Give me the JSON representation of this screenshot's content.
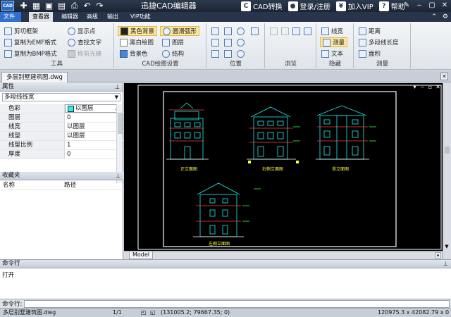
{
  "titlebar": {
    "logo": "CAD",
    "title": "迅捷CAD编辑器",
    "cad_convert": "CAD转换",
    "login": "登录/注册",
    "vip": "加入VIP",
    "help": "帮助",
    "qat_icons": [
      "new-icon",
      "open-icon",
      "save-icon",
      "save-as-icon",
      "print-icon",
      "undo-icon",
      "redo-icon"
    ]
  },
  "menubar": {
    "tabs": [
      "文件",
      "查看器",
      "编辑器",
      "高级",
      "输出",
      "VIP功能"
    ],
    "active": "查看器"
  },
  "ribbon": {
    "tools": {
      "label": "工具",
      "items": [
        "剪切框架",
        "复制为EMF格式",
        "复制为BMP格式",
        "显示点",
        "查找文字",
        "修剪光栅"
      ]
    },
    "cad_settings": {
      "label": "CAD绘图设置",
      "items": [
        "黑色背景",
        "黑白绘图",
        "背景色",
        "圆滑弧形",
        "图层",
        "结构"
      ]
    },
    "position": {
      "label": "位置"
    },
    "browse": {
      "label": "浏览"
    },
    "hide": {
      "label": "隐藏",
      "items": [
        "线宽",
        "测量",
        "文本"
      ]
    },
    "measure": {
      "label": "测量",
      "items": [
        "距离",
        "多段线长度",
        "面积"
      ]
    }
  },
  "file_tab": {
    "name": "多层别墅建筑图.dwg"
  },
  "properties": {
    "title": "属性",
    "selector": "多段线线宽",
    "rows": [
      {
        "key": "色彩",
        "value": "以图层"
      },
      {
        "key": "图层",
        "value": "0"
      },
      {
        "key": "线宽",
        "value": "以图层"
      },
      {
        "key": "线型",
        "value": "以图层"
      },
      {
        "key": "线型比例",
        "value": "1"
      },
      {
        "key": "厚度",
        "value": "0"
      }
    ]
  },
  "favorites": {
    "title": "收藏夹",
    "columns": [
      "名称",
      "路径"
    ]
  },
  "canvas": {
    "model_tab": "Model",
    "elevation_labels": [
      "正立面图",
      "右侧立面图",
      "背立面图",
      "左侧立面图"
    ]
  },
  "command": {
    "title": "命令行",
    "output": "打开",
    "input_label": "命令行:"
  },
  "status": {
    "file": "多层别墅建筑图.dwg",
    "page": "1/1",
    "coords": "(131005.2; 79667.35; 0)",
    "size": "120975.3 x 42082.79 x 0"
  },
  "colors": {
    "title_bg": "#1b2433",
    "canvas_bg": "#000000",
    "cad_cyan": "#1ff0f0",
    "cad_red": "#ff3b3b",
    "cad_green": "#3cff3c",
    "cad_yellow": "#ffff40",
    "highlight": "#fbe7a1"
  }
}
